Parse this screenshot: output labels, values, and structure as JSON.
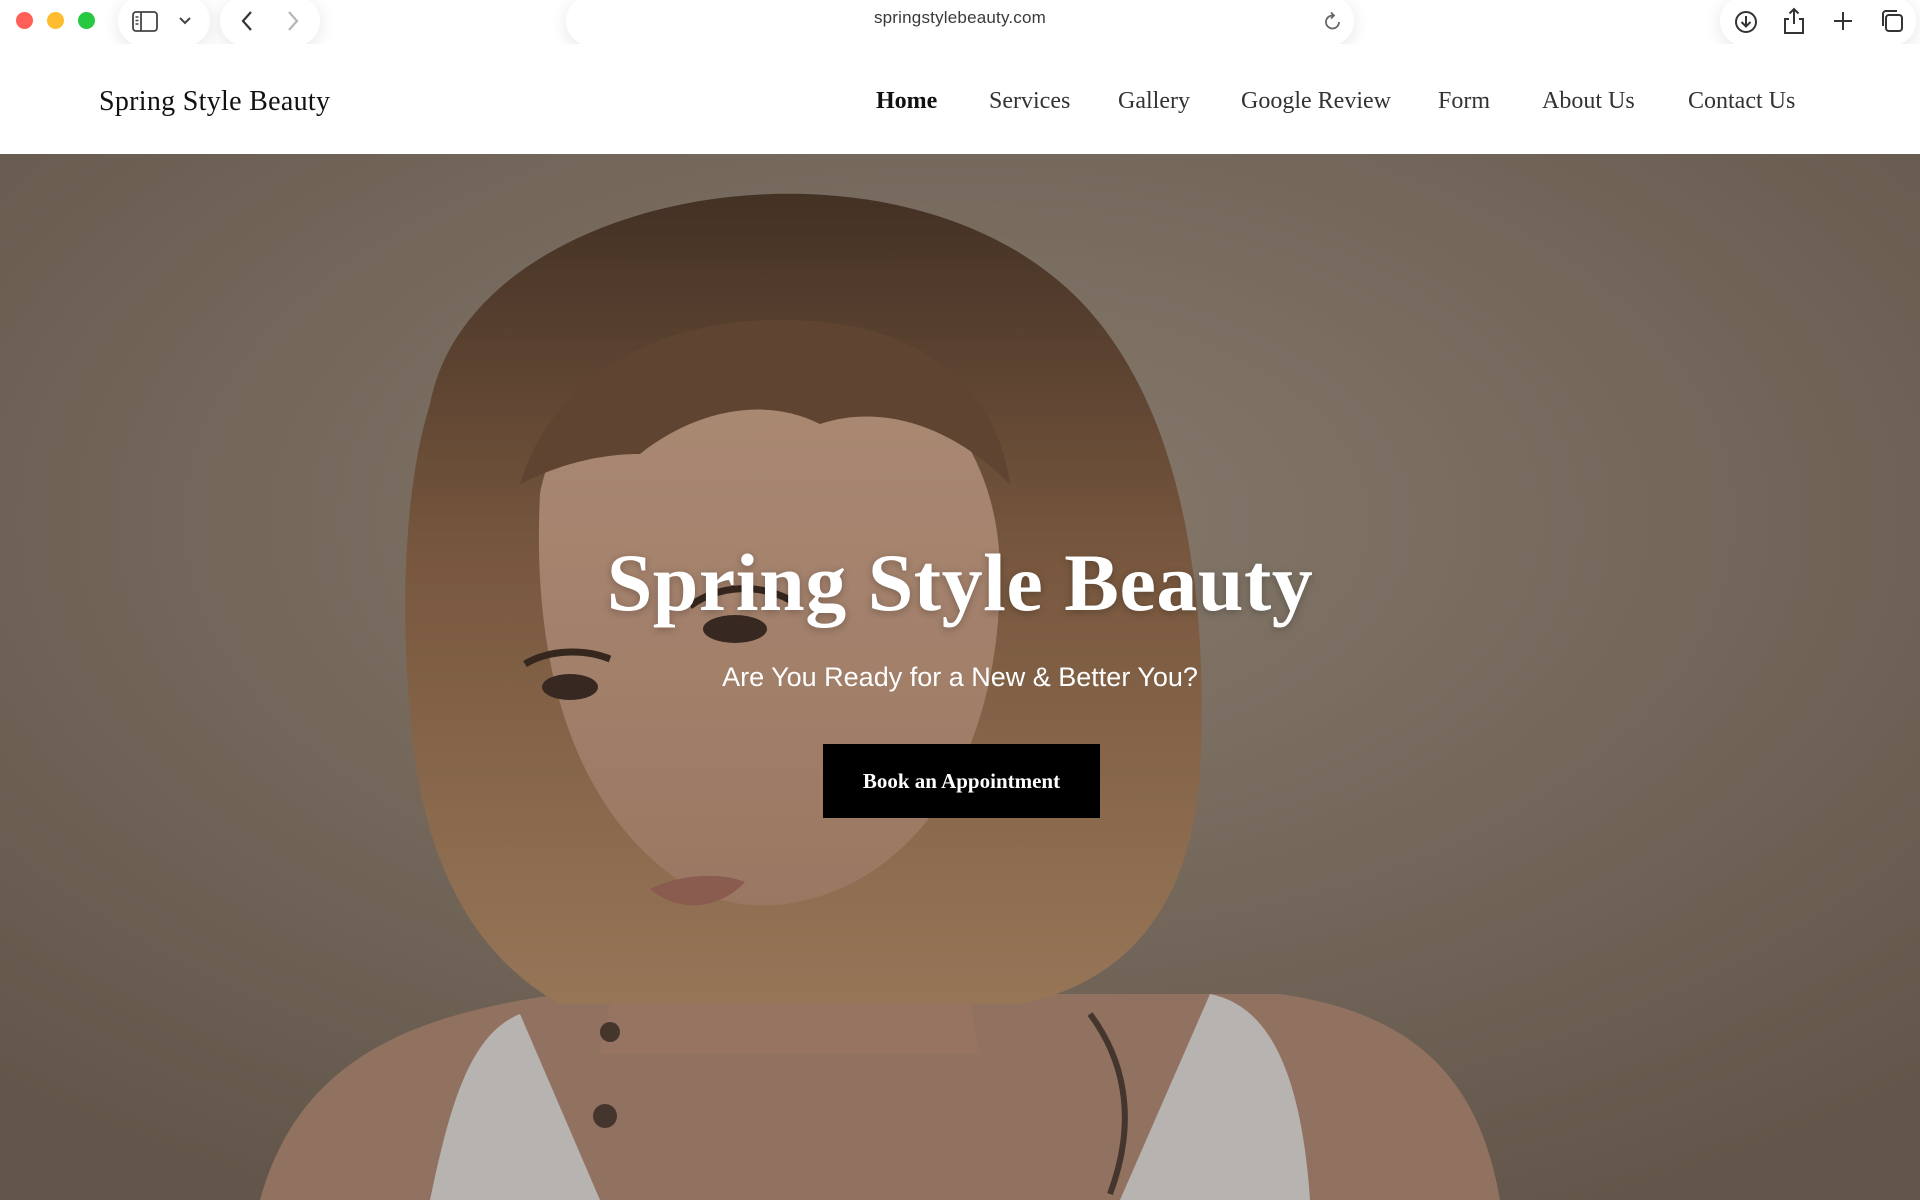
{
  "browser": {
    "url": "springstylebeauty.com",
    "icons": {
      "close": "close-dot",
      "minimize": "minimize-dot",
      "maximize": "maximize-dot",
      "sidebar": "sidebar-icon",
      "sidebar_menu": "chevron-down-icon",
      "back": "chevron-left-icon",
      "forward": "chevron-right-icon",
      "reload": "reload-icon",
      "downloads": "download-icon",
      "share": "share-icon",
      "new_tab": "plus-icon",
      "tabs": "tabs-overview-icon"
    }
  },
  "header": {
    "logo": "Spring Style Beauty",
    "nav": [
      {
        "label": "Home",
        "active": true
      },
      {
        "label": "Services",
        "active": false
      },
      {
        "label": "Gallery",
        "active": false
      },
      {
        "label": "Google Review",
        "active": false
      },
      {
        "label": "Form",
        "active": false
      },
      {
        "label": "About Us",
        "active": false
      },
      {
        "label": "Contact Us",
        "active": false
      }
    ]
  },
  "hero": {
    "title": "Spring Style Beauty",
    "subtitle": "Are You Ready for a New & Better You?",
    "cta_label": "Book an Appointment"
  },
  "colors": {
    "cta_background": "#000000",
    "hero_text": "#ffffff",
    "traffic_close": "#ff5f57",
    "traffic_minimize": "#febc2e",
    "traffic_maximize": "#28c840"
  }
}
